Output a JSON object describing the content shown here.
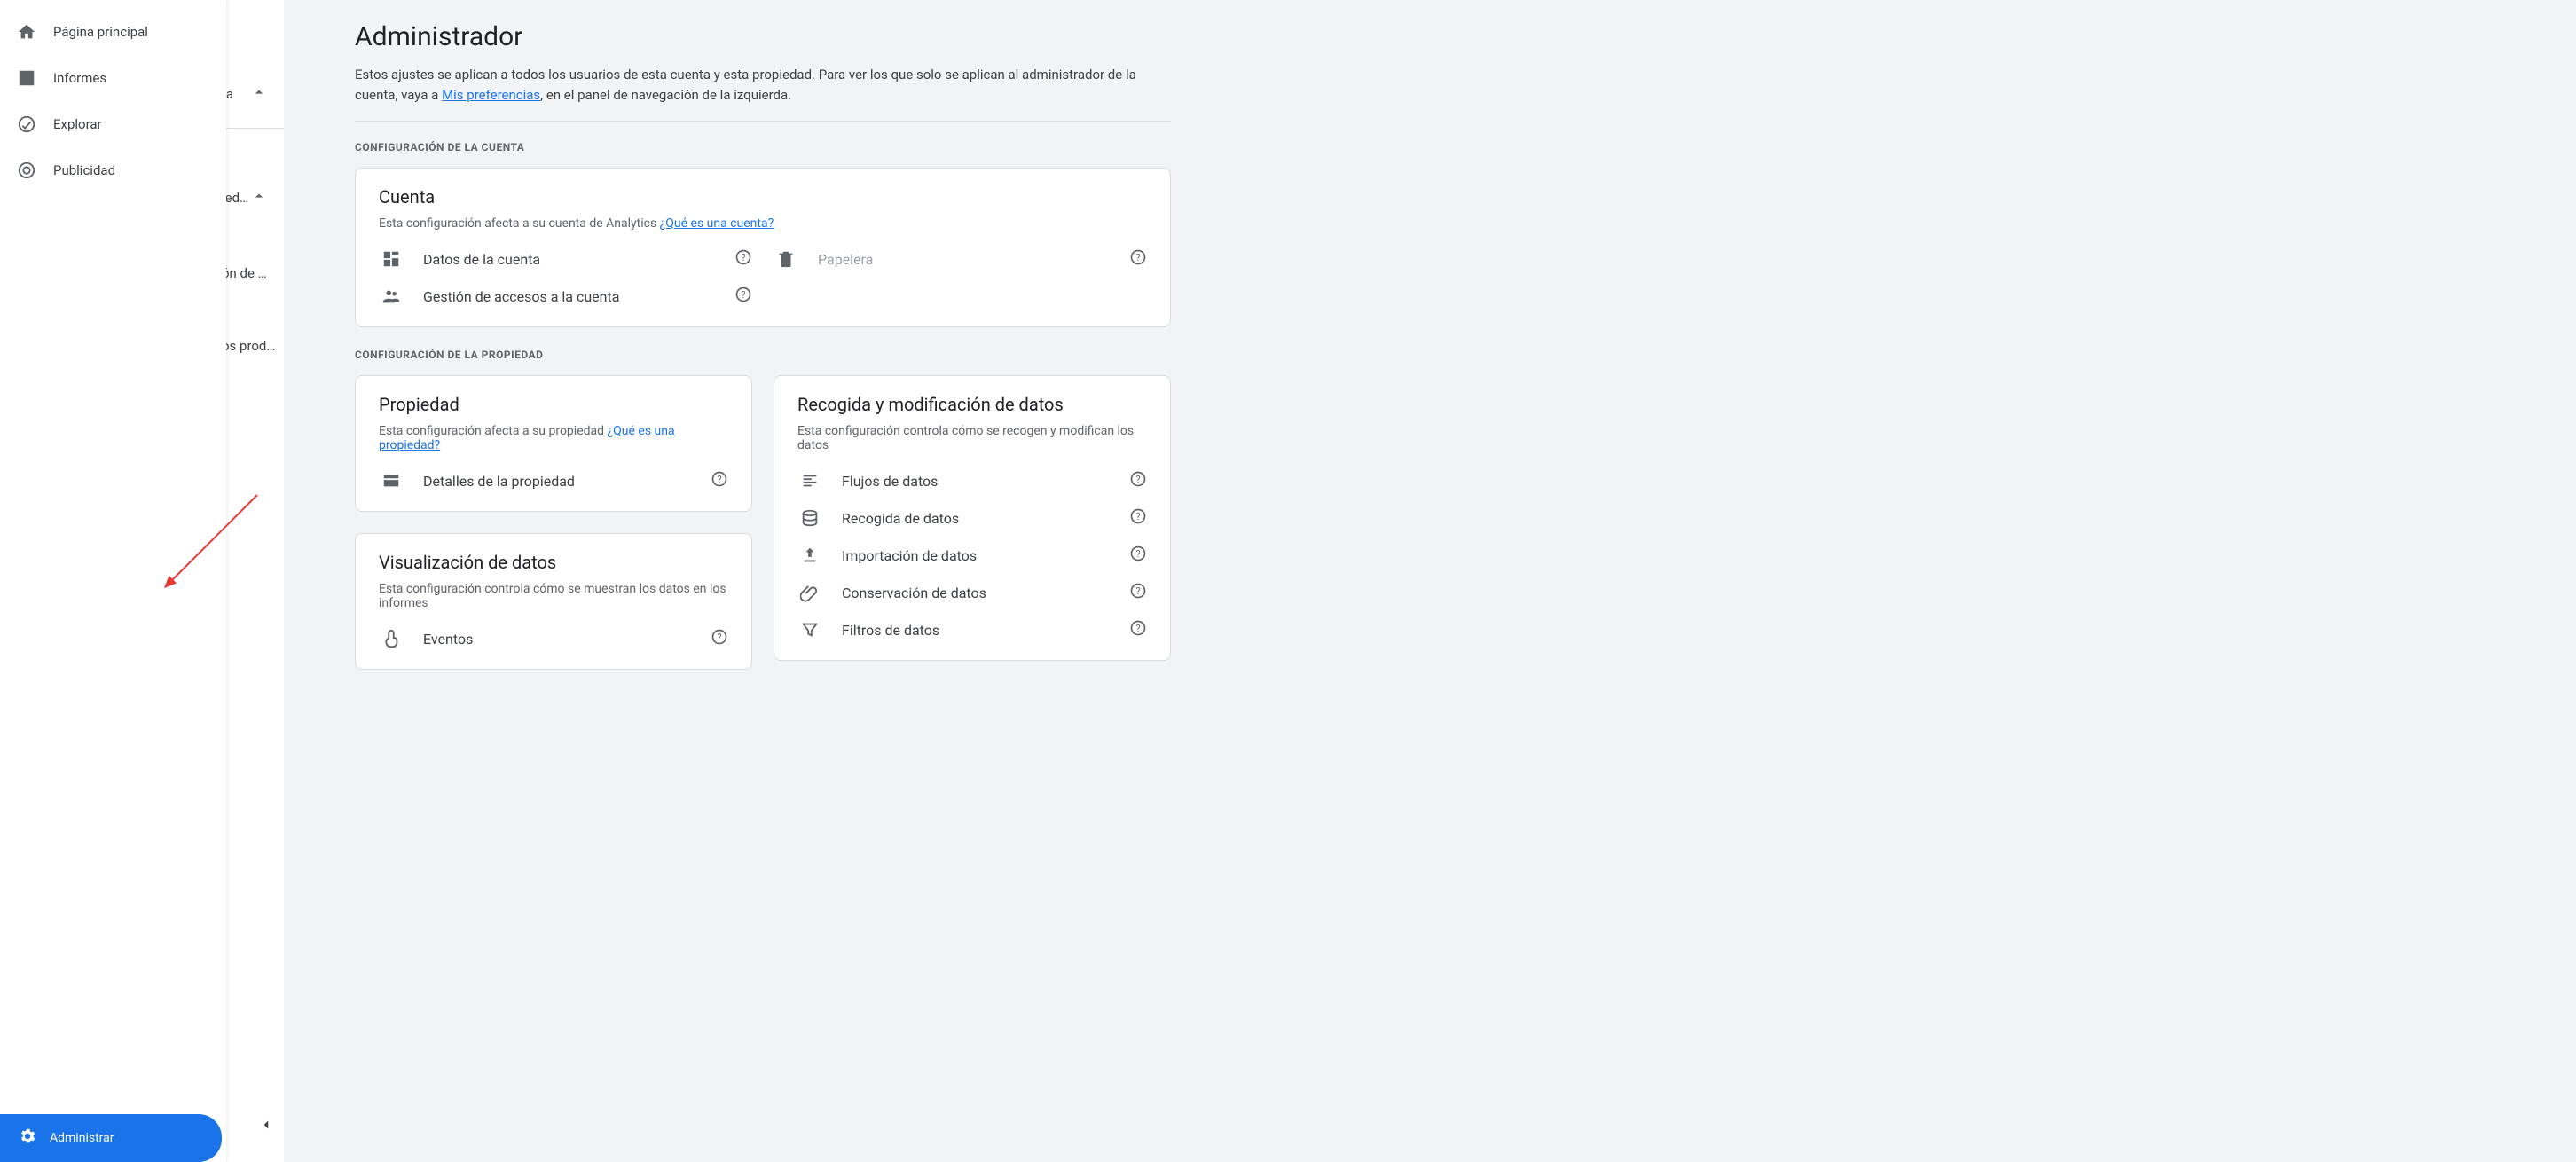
{
  "sidebar": {
    "items": [
      {
        "label": "Página principal"
      },
      {
        "label": "Informes"
      },
      {
        "label": "Explorar"
      },
      {
        "label": "Publicidad"
      }
    ],
    "admin": "Administrar"
  },
  "subpanel": {
    "items": [
      {
        "label": "ta",
        "expanded": true,
        "divider_after": true
      },
      {
        "label": "ied…",
        "expanded": true,
        "divider_after": false
      },
      {
        "label": "ón de …",
        "expanded": false,
        "divider_after": false
      },
      {
        "label": "os prod…",
        "expanded": false,
        "divider_after": false
      }
    ]
  },
  "main": {
    "title": "Administrador",
    "intro_pre": "Estos ajustes se aplican a todos los usuarios de esta cuenta y esta propiedad. Para ver los que solo se aplican al administrador de la cuenta, vaya a ",
    "intro_link": "Mis preferencias",
    "intro_post": ", en el panel de navegación de la izquierda."
  },
  "sections": {
    "account_label": "CONFIGURACIÓN DE LA CUENTA",
    "property_label": "CONFIGURACIÓN DE LA PROPIEDAD"
  },
  "account_card": {
    "title": "Cuenta",
    "desc": "Esta configuración afecta a su cuenta de Analytics ",
    "desc_link": "¿Qué es una cuenta?",
    "rows_left": [
      {
        "label": "Datos de la cuenta"
      },
      {
        "label": "Gestión de accesos a la cuenta"
      }
    ],
    "rows_right": [
      {
        "label": "Papelera",
        "disabled": true
      }
    ]
  },
  "property_card": {
    "title": "Propiedad",
    "desc": "Esta configuración afecta a su propiedad ",
    "desc_link": "¿Qué es una propiedad?",
    "rows": [
      {
        "label": "Detalles de la propiedad"
      }
    ]
  },
  "dataviz_card": {
    "title": "Visualización de datos",
    "desc": "Esta configuración controla cómo se muestran los datos en los informes",
    "rows": [
      {
        "label": "Eventos"
      }
    ]
  },
  "datacollect_card": {
    "title": "Recogida y modificación de datos",
    "desc": "Esta configuración controla cómo se recogen y modifican los datos",
    "rows": [
      {
        "label": "Flujos de datos"
      },
      {
        "label": "Recogida de datos"
      },
      {
        "label": "Importación de datos"
      },
      {
        "label": "Conservación de datos"
      },
      {
        "label": "Filtros de datos"
      }
    ]
  }
}
